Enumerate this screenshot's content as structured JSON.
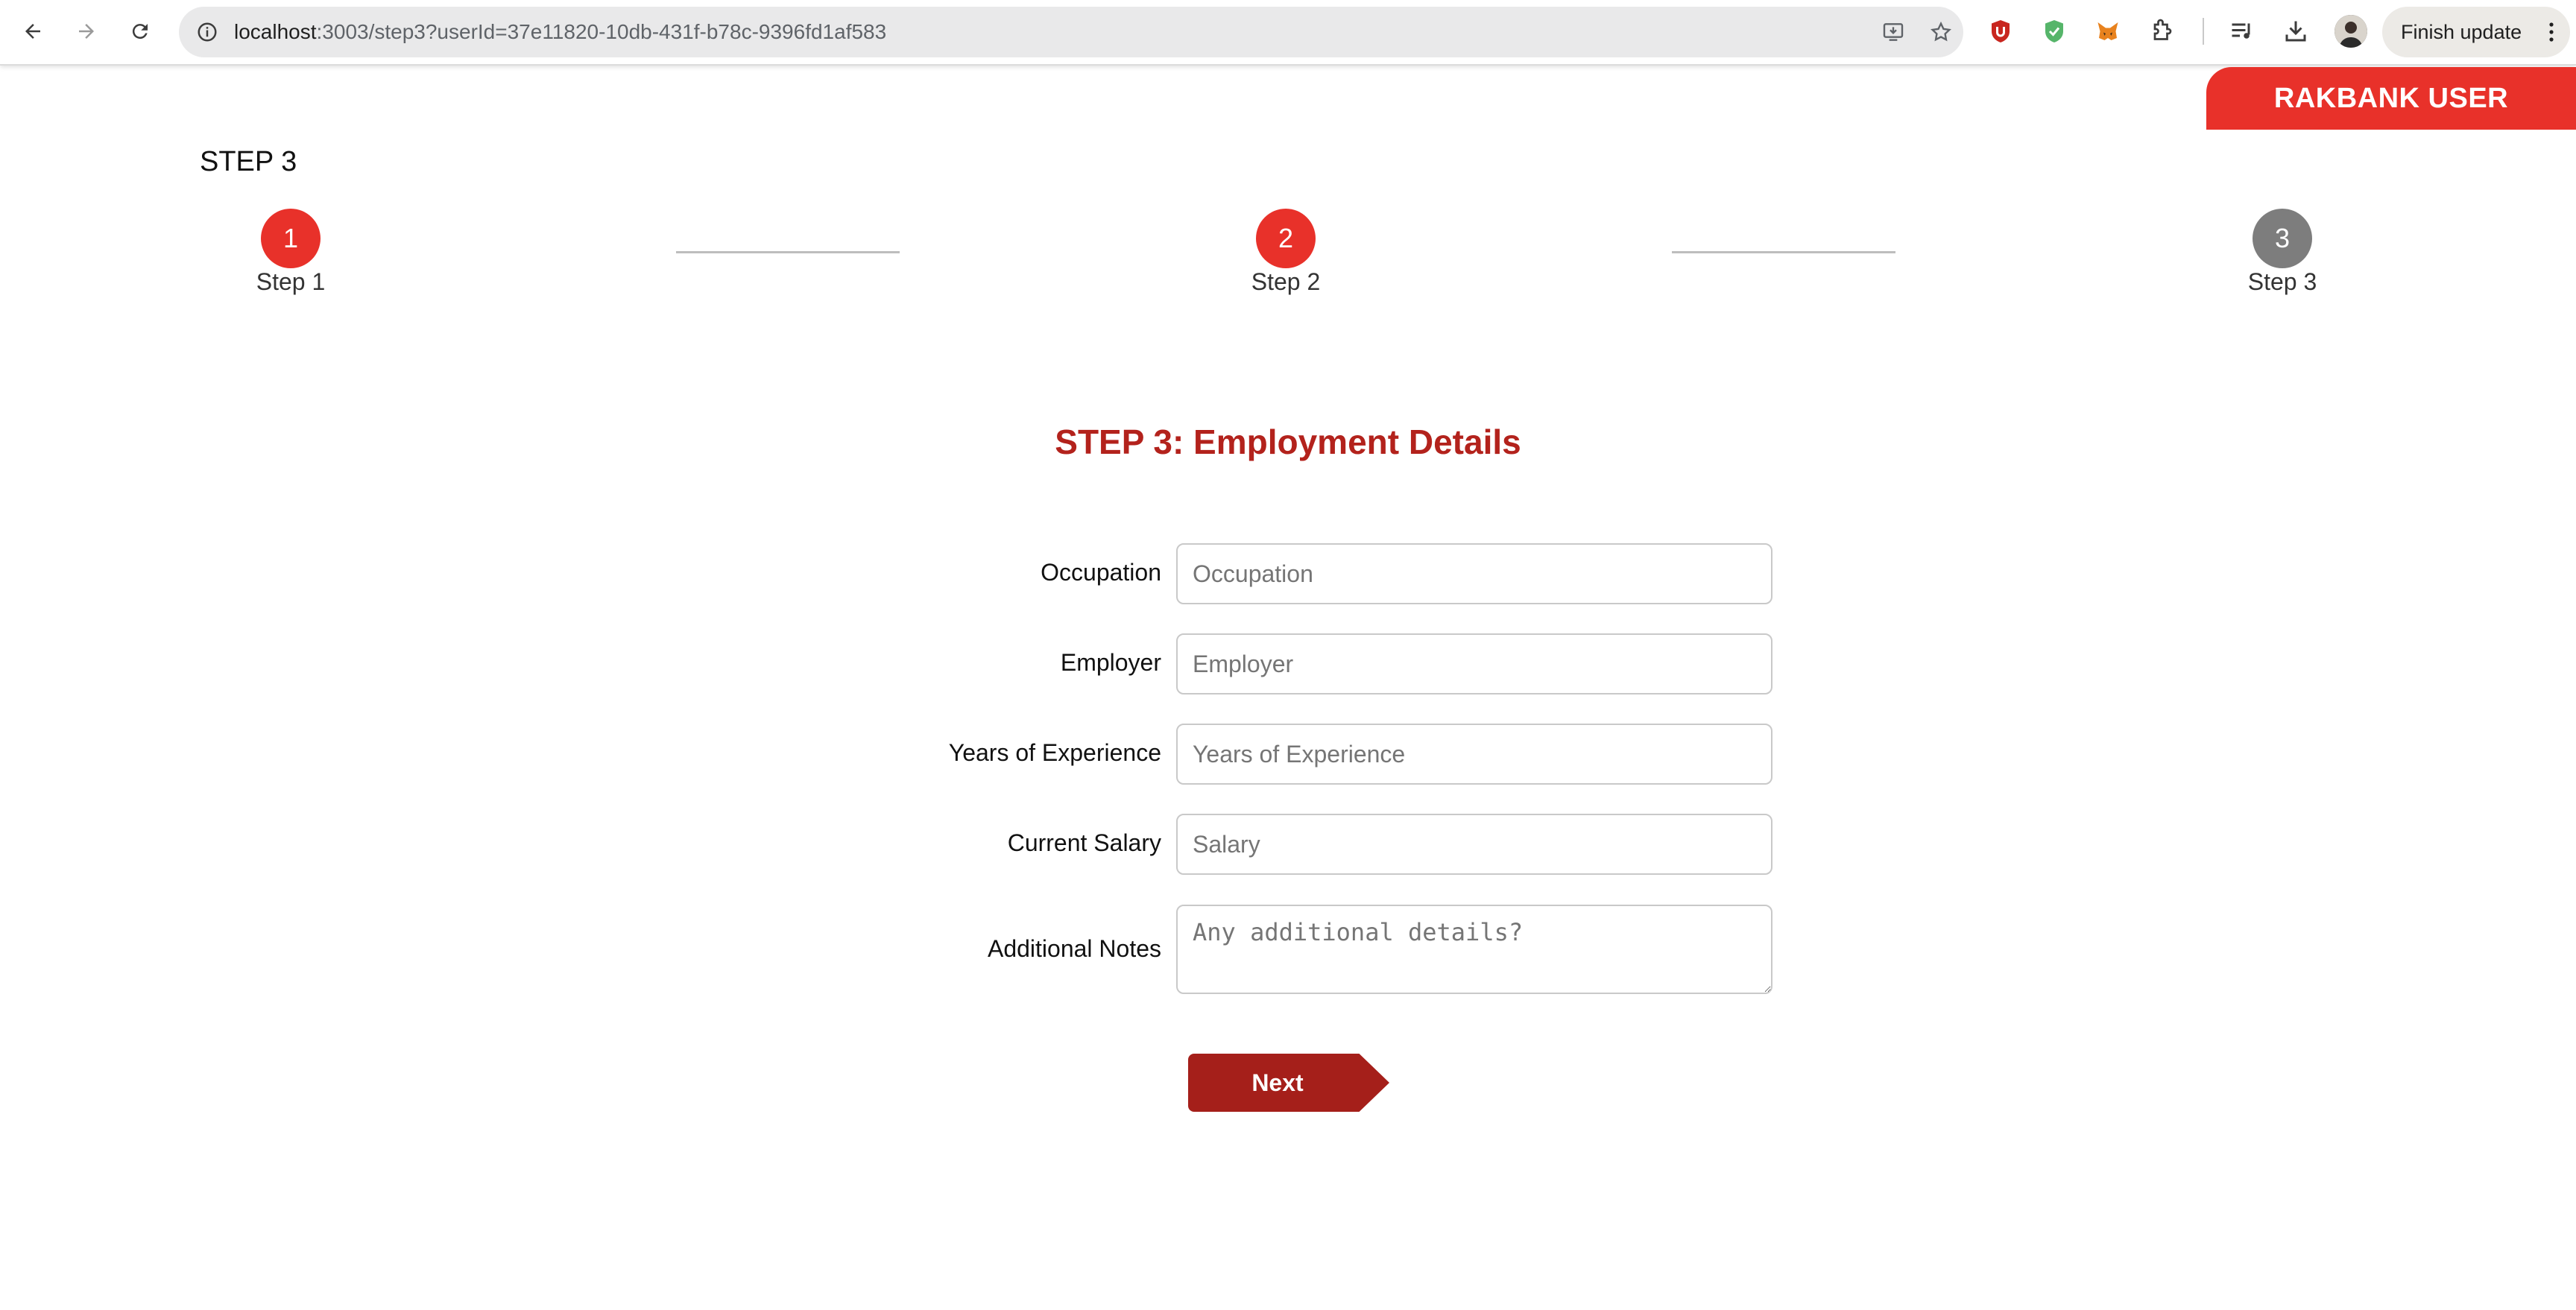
{
  "browser": {
    "url_host": "localhost",
    "url_path": ":3003/step3?userId=37e11820-10db-431f-b78c-9396fd1af583",
    "finish_update_label": "Finish update",
    "icons": [
      "back-icon",
      "forward-icon",
      "reload-icon",
      "info-icon",
      "install-app-icon",
      "bookmark-star-icon",
      "ublock-icon",
      "shield-check-icon",
      "metamask-fox-icon",
      "extensions-puzzle-icon",
      "media-queue-icon",
      "download-icon",
      "profile-avatar",
      "more-vert-icon"
    ]
  },
  "header": {
    "user_badge": "RAKBANK USER",
    "badge_color": "#e8312a"
  },
  "page": {
    "step_heading": "STEP 3"
  },
  "stepper": {
    "steps": [
      {
        "number": "1",
        "label": "Step 1",
        "state": "active"
      },
      {
        "number": "2",
        "label": "Step 2",
        "state": "active"
      },
      {
        "number": "3",
        "label": "Step 3",
        "state": "inactive"
      }
    ],
    "active_color": "#e8312a",
    "inactive_color": "#7d7d7d"
  },
  "form": {
    "title": "STEP 3: Employment Details",
    "title_color": "#b3221c",
    "fields": {
      "occupation": {
        "label": "Occupation",
        "placeholder": "Occupation",
        "value": ""
      },
      "employer": {
        "label": "Employer",
        "placeholder": "Employer",
        "value": ""
      },
      "experience": {
        "label": "Years of Experience",
        "placeholder": "Years of Experience",
        "value": ""
      },
      "salary": {
        "label": "Current Salary",
        "placeholder": "Salary",
        "value": ""
      },
      "notes": {
        "label": "Additional Notes",
        "placeholder": "Any additional details?",
        "value": ""
      }
    },
    "next_label": "Next",
    "next_color": "#a51f1a"
  }
}
